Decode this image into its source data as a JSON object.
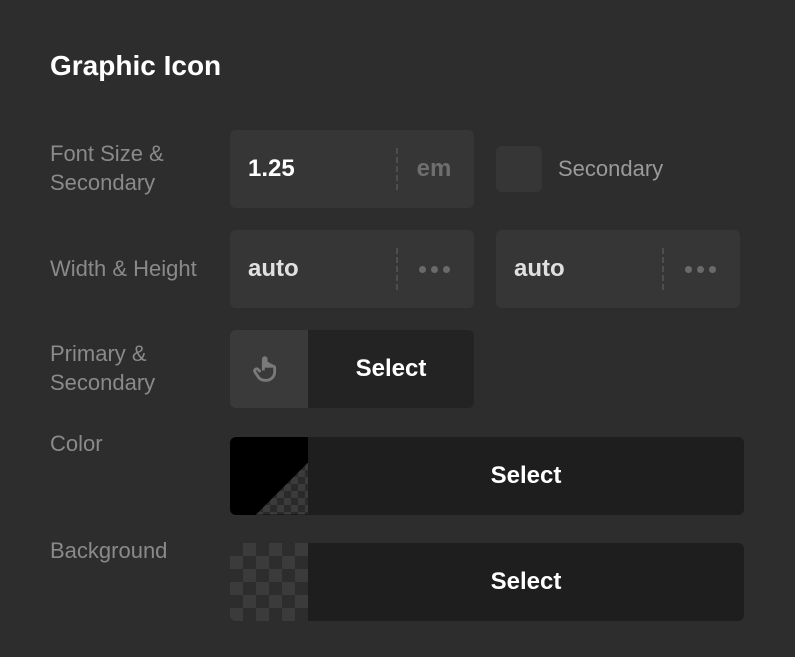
{
  "panel": {
    "title": "Graphic Icon"
  },
  "rows": {
    "fontsize": {
      "label": "Font Size & Secondary",
      "value": "1.25",
      "unit": "em",
      "checkbox_label": "Secondary"
    },
    "wh": {
      "label": "Width & Height",
      "width": "auto",
      "height": "auto"
    },
    "primary": {
      "label": "Primary & Secondary",
      "select": "Select"
    },
    "color": {
      "label": "Color",
      "select": "Select"
    },
    "background": {
      "label": "Background",
      "select": "Select"
    }
  }
}
